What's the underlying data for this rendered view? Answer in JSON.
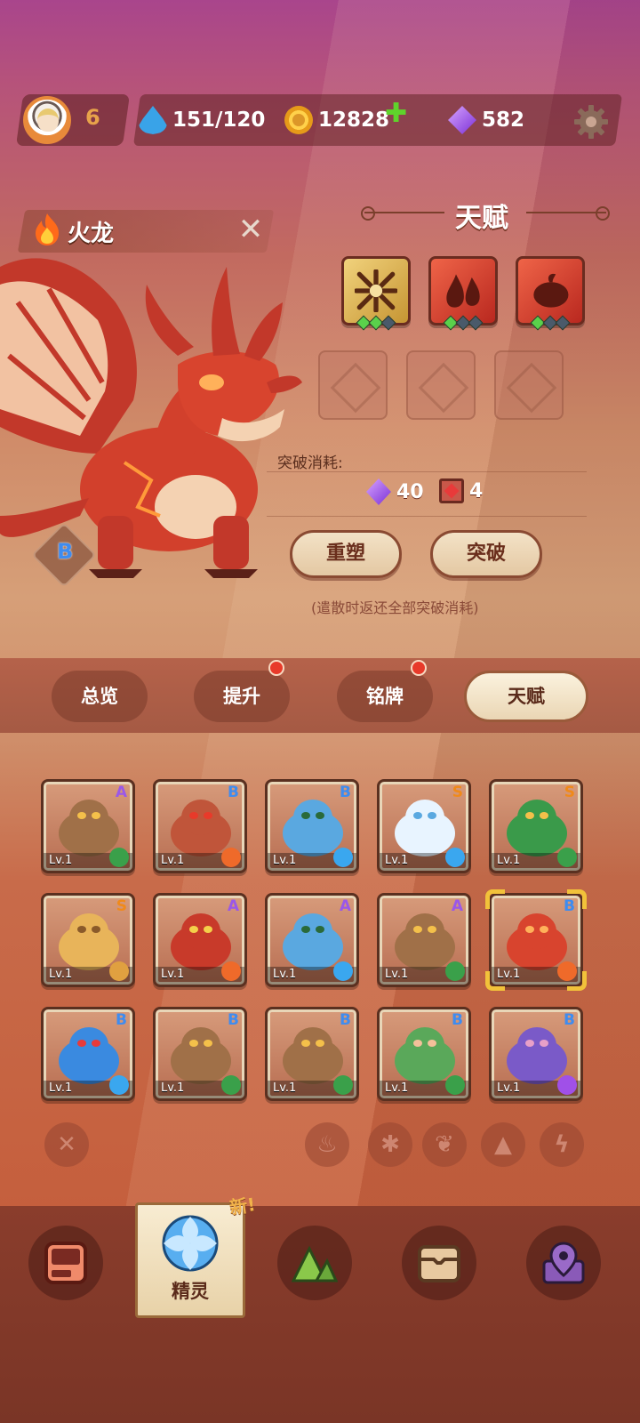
{
  "header": {
    "player_level": "6",
    "resources": {
      "stamina": "151/120",
      "gold": "12828",
      "gems": "582"
    },
    "icons": [
      "avatar",
      "water-drop-icon",
      "coin-icon",
      "plus-icon",
      "gem-icon",
      "gear-icon"
    ]
  },
  "pet": {
    "name": "火龙",
    "rank": "B",
    "element": "fire"
  },
  "talent": {
    "title": "天赋",
    "slots": [
      {
        "style": "gold",
        "icon": "claw-slash-icon",
        "level": 2,
        "max": 3
      },
      {
        "style": "red",
        "icon": "flame-drops-icon",
        "level": 1,
        "max": 3
      },
      {
        "style": "red",
        "icon": "fire-fruit-icon",
        "level": 1,
        "max": 3
      }
    ],
    "locked_slots": 3,
    "breakthrough_cost_label": "突破消耗:",
    "cost_gems": "40",
    "cost_books": "4",
    "reshape_button": "重塑",
    "breakthrough_button": "突破",
    "hint": "(遣散时返还全部突破消耗)"
  },
  "tabs": [
    {
      "label": "总览",
      "active": false,
      "dot": false
    },
    {
      "label": "提升",
      "active": false,
      "dot": true
    },
    {
      "label": "铭牌",
      "active": false,
      "dot": true
    },
    {
      "label": "天赋",
      "active": true,
      "dot": false
    }
  ],
  "pets_grid": [
    {
      "rank": "A",
      "level": "Lv.1",
      "element": "leaf",
      "creature": "tree-stump"
    },
    {
      "rank": "B",
      "level": "Lv.1",
      "element": "fire",
      "creature": "furnace-bot"
    },
    {
      "rank": "B",
      "level": "Lv.1",
      "element": "ice",
      "creature": "blue-deer"
    },
    {
      "rank": "S",
      "level": "Lv.1",
      "element": "ice",
      "creature": "ice-spirit"
    },
    {
      "rank": "S",
      "level": "Lv.1",
      "element": "leaf",
      "creature": "green-serpent"
    },
    {
      "rank": "S",
      "level": "Lv.1",
      "element": "rock",
      "creature": "golden-blob"
    },
    {
      "rank": "A",
      "level": "Lv.1",
      "element": "fire",
      "creature": "red-minotaur"
    },
    {
      "rank": "A",
      "level": "Lv.1",
      "element": "ice",
      "creature": "blue-deer"
    },
    {
      "rank": "A",
      "level": "Lv.1",
      "element": "leaf",
      "creature": "tree-stump"
    },
    {
      "rank": "B",
      "level": "Lv.1",
      "element": "fire",
      "creature": "fire-dragon",
      "selected": true
    },
    {
      "rank": "B",
      "level": "Lv.1",
      "element": "ice",
      "creature": "blue-fish"
    },
    {
      "rank": "B",
      "level": "Lv.1",
      "element": "leaf",
      "creature": "tree-stump"
    },
    {
      "rank": "B",
      "level": "Lv.1",
      "element": "leaf",
      "creature": "tree-stump"
    },
    {
      "rank": "B",
      "level": "Lv.1",
      "element": "leaf",
      "creature": "green-monkey"
    },
    {
      "rank": "B",
      "level": "Lv.1",
      "element": "bolt",
      "creature": "purple-mouse"
    }
  ],
  "filters": [
    "clear-filter-icon",
    "fire-filter-icon",
    "ice-filter-icon",
    "leaf-filter-icon",
    "rock-filter-icon",
    "bolt-filter-icon"
  ],
  "bottom_nav": {
    "active_label": "精灵",
    "new_badge": "新!",
    "items": [
      "console-icon",
      "spirit-orb-icon",
      "mountain-icon",
      "chest-icon",
      "map-pin-icon"
    ]
  },
  "colors": {
    "accent_gold": "#f2c23a",
    "rank_a": "#9a58e8",
    "rank_b": "#3e8cf0",
    "rank_s": "#f08a1a",
    "notification": "#e83a2a"
  }
}
